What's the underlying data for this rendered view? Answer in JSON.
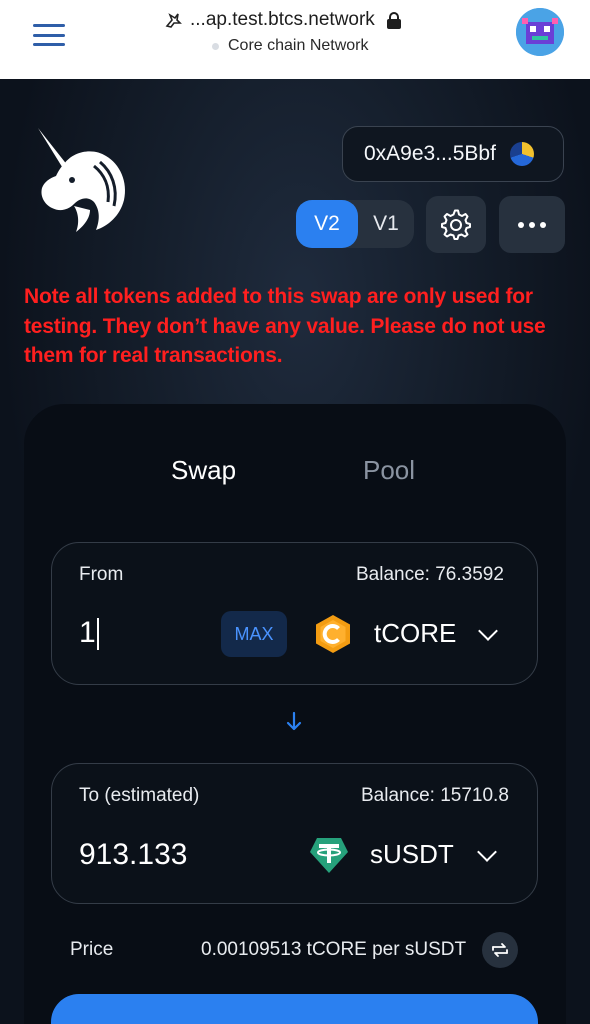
{
  "browser": {
    "url": "...ap.test.btcs.network",
    "network": "Core chain Network"
  },
  "header": {
    "wallet_address": "0xA9e3...5Bbf",
    "version_active": "V2",
    "version_inactive": "V1"
  },
  "warning": "Note all tokens added to this swap are only used for testing. They don’t have any value. Please do not use them for real transactions.",
  "tabs": {
    "swap": "Swap",
    "pool": "Pool"
  },
  "from": {
    "label": "From",
    "balance": "Balance: 76.3592",
    "amount": "1",
    "max_label": "MAX",
    "token": "tCORE"
  },
  "to": {
    "label": "To (estimated)",
    "balance": "Balance: 15710.8",
    "amount": "913.133",
    "token": "sUSDT"
  },
  "price": {
    "label": "Price",
    "value": "0.00109513 tCORE per sUSDT"
  },
  "colors": {
    "accent": "#2b80f0",
    "warning": "#ff1f1f",
    "core_token": "#f39c12",
    "usdt_token": "#26a17b"
  }
}
